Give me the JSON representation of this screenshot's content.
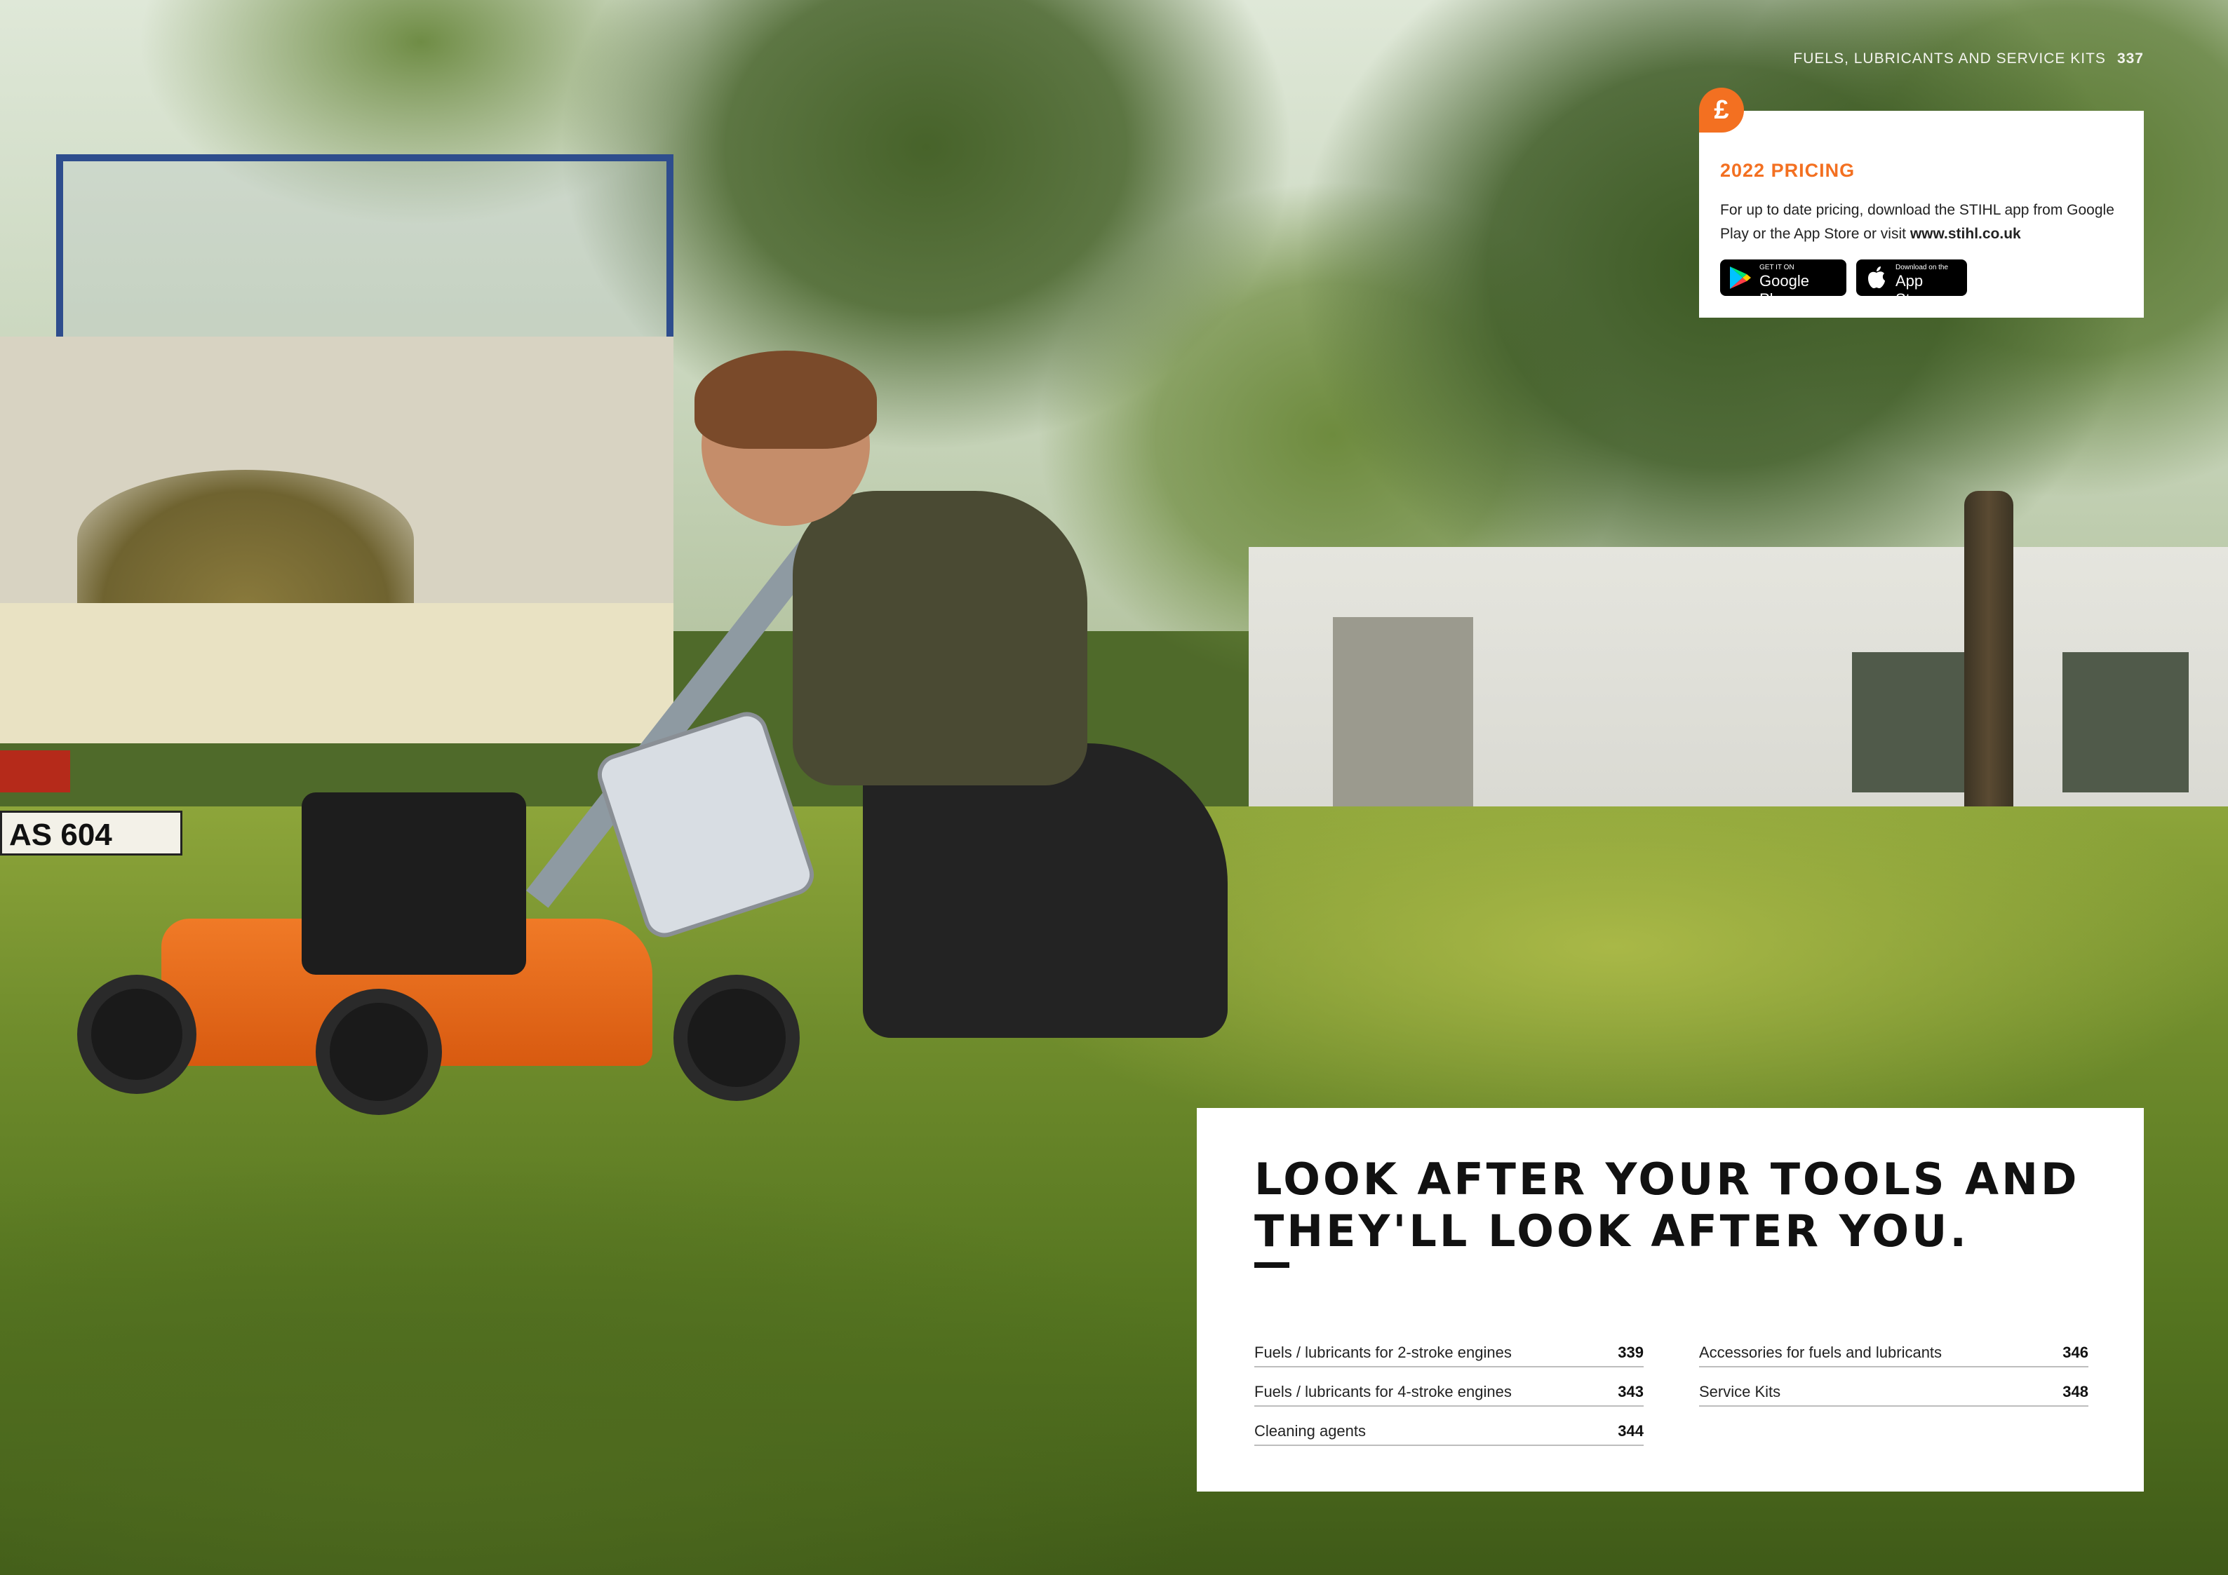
{
  "header": {
    "section_title": "FUELS, LUBRICANTS AND SERVICE KITS",
    "page_number": "337"
  },
  "pricing": {
    "icon": "pound-sign-icon",
    "icon_glyph": "£",
    "title": "2022 PRICING",
    "text": "For up to date pricing, download the STIHL app from Google Play or the App Store or visit",
    "url": "www.stihl.co.uk",
    "google_play": {
      "small": "GET IT ON",
      "big": "Google Play"
    },
    "app_store": {
      "small": "Download on the",
      "big": "App Store"
    }
  },
  "photo": {
    "plate_text": "AS 604"
  },
  "toc": {
    "headline_line1": "LOOK AFTER YOUR TOOLS AND",
    "headline_line2": "THEY'LL LOOK AFTER YOU.",
    "left": [
      {
        "label": "Fuels / lubricants for 2-stroke engines",
        "page": "339"
      },
      {
        "label": "Fuels / lubricants for 4-stroke engines",
        "page": "343"
      },
      {
        "label": "Cleaning agents",
        "page": "344"
      }
    ],
    "right": [
      {
        "label": "Accessories for fuels and lubricants",
        "page": "346"
      },
      {
        "label": "Service Kits",
        "page": "348"
      }
    ]
  },
  "colors": {
    "accent": "#f37021",
    "card": "#ffffff",
    "text": "#111111"
  }
}
